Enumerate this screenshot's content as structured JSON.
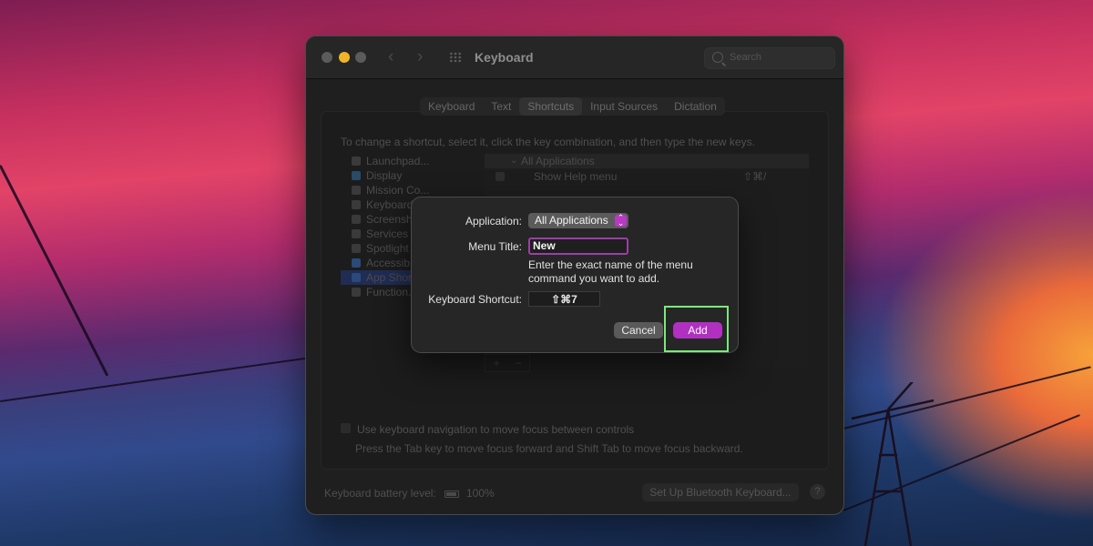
{
  "window": {
    "title": "Keyboard",
    "search_placeholder": "Search"
  },
  "tabs": [
    "Keyboard",
    "Text",
    "Shortcuts",
    "Input Sources",
    "Dictation"
  ],
  "active_tab": "Shortcuts",
  "instructions": "To change a shortcut, select it, click the key combination, and then type the new keys.",
  "sidebar": {
    "items": [
      {
        "label": "Launchpad...",
        "icon": "launchpad-icon"
      },
      {
        "label": "Display",
        "icon": "display-icon"
      },
      {
        "label": "Mission Co...",
        "icon": "mission-control-icon"
      },
      {
        "label": "Keyboard",
        "icon": "keyboard-icon"
      },
      {
        "label": "Screensh...",
        "icon": "screenshot-icon"
      },
      {
        "label": "Services",
        "icon": "services-icon"
      },
      {
        "label": "Spotlight",
        "icon": "spotlight-icon"
      },
      {
        "label": "Accessib...",
        "icon": "accessibility-icon"
      },
      {
        "label": "App Shor...",
        "icon": "app-shortcuts-icon"
      },
      {
        "label": "Function...",
        "icon": "function-keys-icon"
      }
    ],
    "selected": "App Shor..."
  },
  "shortcuts_table": {
    "group": "All Applications",
    "rows": [
      {
        "name": "Show Help menu",
        "shortcut": "⇧⌘/"
      }
    ],
    "add_label": "+",
    "remove_label": "−"
  },
  "keyboard_navigation": {
    "label": "Use keyboard navigation to move focus between controls",
    "hint": "Press the Tab key to move focus forward and Shift Tab to move focus backward."
  },
  "footer": {
    "battery_label": "Keyboard battery level:",
    "battery_value": "100%",
    "bluetooth_button": "Set Up Bluetooth Keyboard...",
    "help_button": "?"
  },
  "sheet": {
    "application_label": "Application:",
    "application_value": "All Applications",
    "menu_title_label": "Menu Title:",
    "menu_title_value": "New",
    "help_text": "Enter the exact name of the menu command you want to add.",
    "shortcut_label": "Keyboard Shortcut:",
    "shortcut_value": "⇧⌘7",
    "cancel_label": "Cancel",
    "add_label": "Add"
  },
  "colors": {
    "accent": "#b030c0",
    "highlight": "#7bea7b"
  }
}
